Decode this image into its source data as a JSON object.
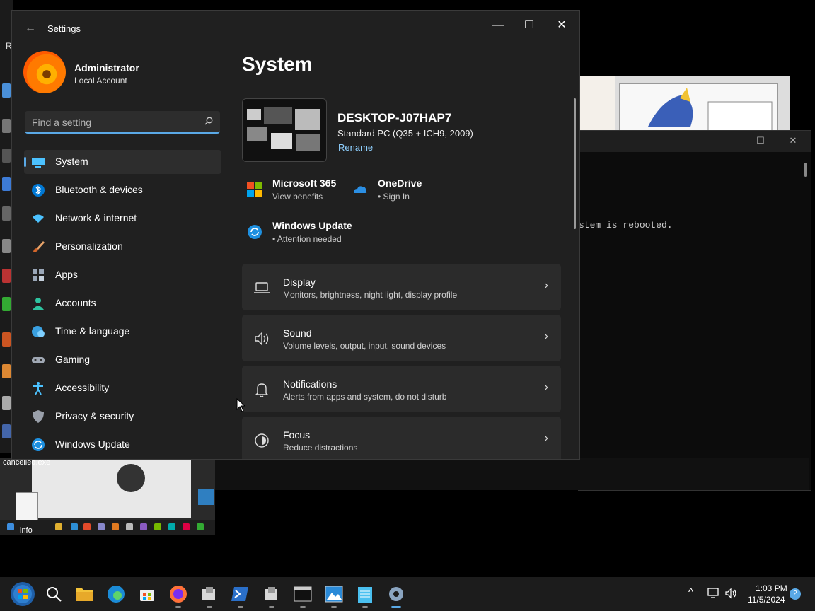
{
  "settings": {
    "window_title": "Settings",
    "back_glyph": "←",
    "minimize_glyph": "—",
    "maximize_glyph": "☐",
    "close_glyph": "✕",
    "user": {
      "name": "Administrator",
      "account_type": "Local Account"
    },
    "search": {
      "placeholder": "Find a setting",
      "value": ""
    },
    "nav": [
      {
        "label": "System",
        "icon": "monitor-icon",
        "selected": true
      },
      {
        "label": "Bluetooth & devices",
        "icon": "bluetooth-icon"
      },
      {
        "label": "Network & internet",
        "icon": "wifi-icon"
      },
      {
        "label": "Personalization",
        "icon": "brush-icon"
      },
      {
        "label": "Apps",
        "icon": "apps-icon"
      },
      {
        "label": "Accounts",
        "icon": "person-icon"
      },
      {
        "label": "Time & language",
        "icon": "globe-clock-icon"
      },
      {
        "label": "Gaming",
        "icon": "gamepad-icon"
      },
      {
        "label": "Accessibility",
        "icon": "accessibility-icon"
      },
      {
        "label": "Privacy & security",
        "icon": "shield-icon"
      },
      {
        "label": "Windows Update",
        "icon": "update-icon"
      }
    ],
    "page_title": "System",
    "device": {
      "name": "DESKTOP-J07HAP7",
      "model": "Standard PC (Q35 + ICH9, 2009)",
      "rename_label": "Rename"
    },
    "quick": {
      "m365": {
        "title": "Microsoft 365",
        "sub": "View benefits"
      },
      "onedrive": {
        "title": "OneDrive",
        "sub": "• Sign In"
      },
      "update": {
        "title": "Windows Update",
        "sub": "• Attention needed"
      }
    },
    "cards": [
      {
        "title": "Display",
        "sub": "Monitors, brightness, night light, display profile",
        "icon": "laptop-icon"
      },
      {
        "title": "Sound",
        "sub": "Volume levels, output, input, sound devices",
        "icon": "speaker-icon"
      },
      {
        "title": "Notifications",
        "sub": "Alerts from apps and system, do not disturb",
        "icon": "bell-icon"
      },
      {
        "title": "Focus",
        "sub": "Reduce distractions",
        "icon": "focus-icon"
      }
    ],
    "chevron_glyph": "›"
  },
  "background": {
    "desktop_letter": "R",
    "terminal_text": "stem is rebooted.",
    "terminal_min_glyph": "—",
    "terminal_max_glyph": "☐",
    "terminal_close_glyph": "✕",
    "mini_desktop_label": "cancelled.exe",
    "mini_info_label": "info"
  },
  "taskbar": {
    "items": [
      "start-orb-icon",
      "search-icon",
      "file-explorer-icon",
      "edge-icon",
      "store-icon",
      "firefox-icon",
      "installer-icon",
      "powershell-icon",
      "installer-icon-2",
      "terminal-icon",
      "photos-icon",
      "notepad-icon",
      "settings-icon"
    ],
    "tray_chevron": "^",
    "time": "1:03 PM",
    "date": "11/5/2024",
    "notification_count": "2"
  },
  "colors": {
    "accent": "#5aa9e6",
    "window_bg": "#202020",
    "card_bg": "#2b2b2b",
    "link": "#8fd0ff"
  }
}
